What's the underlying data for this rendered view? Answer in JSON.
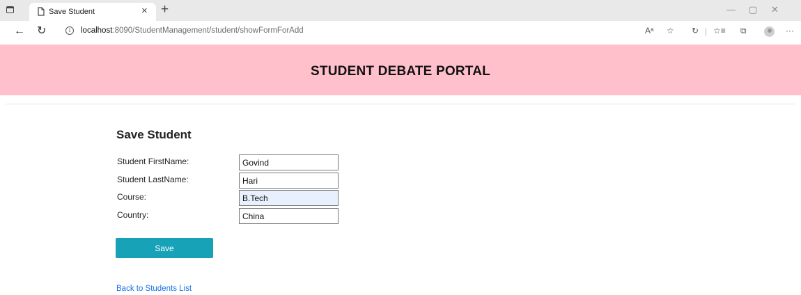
{
  "browser": {
    "tab_title": "Save Student",
    "tab_close": "×",
    "new_tab": "+",
    "url_host": "localhost",
    "url_path": ":8090/StudentManagement/student/showFormForAdd",
    "back": "←",
    "reload": "↻",
    "info": "i",
    "read_aloud": "Aᵃ",
    "favorites_star": "☆",
    "refresh_icon": "↻",
    "favorites_list": "☆≡",
    "collections": "⧉",
    "more": "···",
    "minimize": "—",
    "restore": "▢",
    "close": "✕"
  },
  "page": {
    "portal_title": "STUDENT DEBATE PORTAL",
    "form_heading": "Save Student",
    "fields": [
      {
        "label": "Student FirstName:",
        "value": "Govind"
      },
      {
        "label": "Student LastName:",
        "value": "Hari"
      },
      {
        "label": "Course:",
        "value": "B.Tech"
      },
      {
        "label": "Country:",
        "value": "China"
      }
    ],
    "save_label": "Save",
    "back_link": "Back to Students List"
  },
  "colors": {
    "banner": "#ffc0cb",
    "save_button": "#17a2b8",
    "link": "#1a73e8",
    "autofill": "#e8f0fe"
  }
}
